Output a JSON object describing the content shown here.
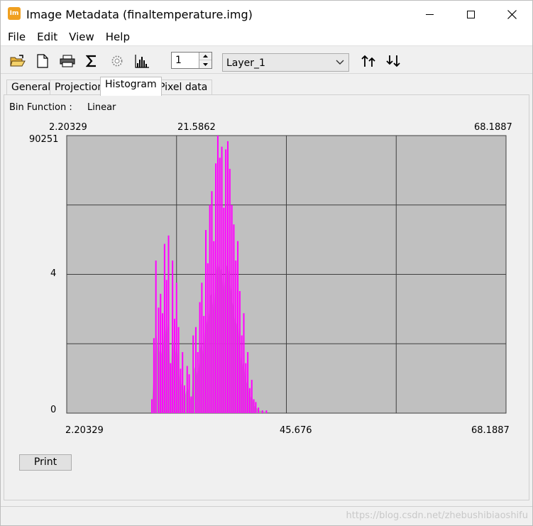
{
  "window": {
    "title": "Image Metadata (finaltemperature.img)",
    "app_icon_text": "Im"
  },
  "menu": [
    "File",
    "Edit",
    "View",
    "Help"
  ],
  "toolbar": {
    "icons": [
      "open-folder-icon",
      "new-document-icon",
      "print-icon",
      "sigma-icon",
      "gear-icon",
      "histogram-icon"
    ],
    "spinner_value": "1",
    "layer_value": "Layer_1",
    "sort_ascending_icon": "sort-up-icon",
    "sort_descending_icon": "sort-down-icon"
  },
  "tabs": [
    {
      "label": "General",
      "active": false
    },
    {
      "label": "Projection",
      "active": false
    },
    {
      "label": "Histogram",
      "active": true
    },
    {
      "label": "Pixel data",
      "active": false
    }
  ],
  "histogram": {
    "bin_function_label": "Bin Function :",
    "bin_function_value": "Linear",
    "top_labels": [
      "2.20329",
      "21.5862",
      "68.1887"
    ],
    "bottom_labels": [
      "2.20329",
      "45.676",
      "68.1887"
    ],
    "y_labels": [
      "90251",
      "4",
      "0"
    ]
  },
  "print_label": "Print",
  "watermark": "https://blog.csdn.net/zhebushibiaoshifu",
  "chart_data": {
    "type": "bar",
    "x_min": 2.20329,
    "x_max": 68.1887,
    "y_max": 90251,
    "colors": {
      "plot_bg": "#c0c0c0",
      "grid": "#404040",
      "bars": "#ff00ff",
      "fill": "#a0a0a0"
    },
    "series": [
      {
        "values": [
          [
            15.0,
            0.05
          ],
          [
            15.3,
            0.27
          ],
          [
            15.6,
            0.55
          ],
          [
            16.0,
            0.38
          ],
          [
            16.3,
            0.43
          ],
          [
            16.6,
            0.36
          ],
          [
            16.9,
            0.61
          ],
          [
            17.2,
            0.48
          ],
          [
            17.5,
            0.64
          ],
          [
            17.8,
            0.18
          ],
          [
            18.1,
            0.55
          ],
          [
            18.4,
            0.34
          ],
          [
            18.7,
            0.47
          ],
          [
            19.0,
            0.31
          ],
          [
            19.3,
            0.16
          ],
          [
            19.6,
            0.22
          ],
          [
            19.9,
            0.1
          ],
          [
            20.3,
            0.17
          ],
          [
            20.6,
            0.14
          ],
          [
            20.9,
            0.06
          ],
          [
            21.2,
            0.28
          ],
          [
            21.6,
            0.31
          ],
          [
            21.9,
            0.22
          ],
          [
            22.2,
            0.4
          ],
          [
            22.5,
            0.47
          ],
          [
            22.8,
            0.35
          ],
          [
            23.1,
            0.66
          ],
          [
            23.4,
            0.54
          ],
          [
            23.7,
            0.75
          ],
          [
            24.0,
            0.8
          ],
          [
            24.3,
            0.62
          ],
          [
            24.6,
            0.9
          ],
          [
            24.9,
            1.0
          ],
          [
            25.2,
            0.92
          ],
          [
            25.5,
            0.96
          ],
          [
            25.8,
            0.74
          ],
          [
            26.1,
            0.95
          ],
          [
            26.4,
            0.98
          ],
          [
            26.7,
            0.88
          ],
          [
            27.0,
            0.75
          ],
          [
            27.3,
            0.68
          ],
          [
            27.6,
            0.55
          ],
          [
            27.9,
            0.62
          ],
          [
            28.2,
            0.44
          ],
          [
            28.5,
            0.28
          ],
          [
            28.8,
            0.36
          ],
          [
            29.1,
            0.18
          ],
          [
            29.4,
            0.22
          ],
          [
            29.7,
            0.09
          ],
          [
            30.0,
            0.12
          ],
          [
            30.3,
            0.05
          ],
          [
            30.6,
            0.04
          ],
          [
            31.0,
            0.02
          ],
          [
            31.6,
            0.01
          ],
          [
            32.2,
            0.01
          ]
        ]
      }
    ]
  }
}
